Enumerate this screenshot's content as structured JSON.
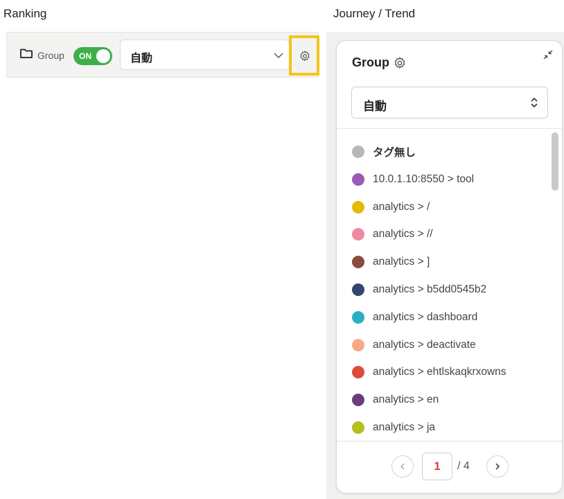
{
  "columns": {
    "left_title": "Ranking",
    "right_title": "Journey / Trend"
  },
  "left_toolbar": {
    "group_label": "Group",
    "toggle_label": "ON",
    "toggle_state": "on",
    "select_value": "自動",
    "folder_icon": "folder-icon",
    "settings_icon": "gear-icon",
    "highlight_color": "#f2c418"
  },
  "card": {
    "title": "Group",
    "select_value": "自動",
    "items": [
      {
        "label": "タグ無し",
        "color": "#b8b8b8"
      },
      {
        "label": "10.0.1.10:8550 > tool",
        "color": "#9b59b6"
      },
      {
        "label": "analytics > /",
        "color": "#e6b800"
      },
      {
        "label": "analytics > //",
        "color": "#f08aa0"
      },
      {
        "label": "analytics > ]",
        "color": "#8b4a3c"
      },
      {
        "label": "analytics > b5dd0545b2",
        "color": "#34456e"
      },
      {
        "label": "analytics > dashboard",
        "color": "#2ab0c4"
      },
      {
        "label": "analytics > deactivate",
        "color": "#f7a987"
      },
      {
        "label": "analytics > ehtlskaqkrxowns",
        "color": "#dd4b39"
      },
      {
        "label": "analytics > en",
        "color": "#6b3d7a"
      },
      {
        "label": "analytics > ja",
        "color": "#b5bf1e"
      }
    ],
    "pagination": {
      "current": "1",
      "total": "/ 4"
    }
  },
  "colors": {
    "toggle_on": "#3fae4a",
    "page_current": "#e03a3a"
  }
}
